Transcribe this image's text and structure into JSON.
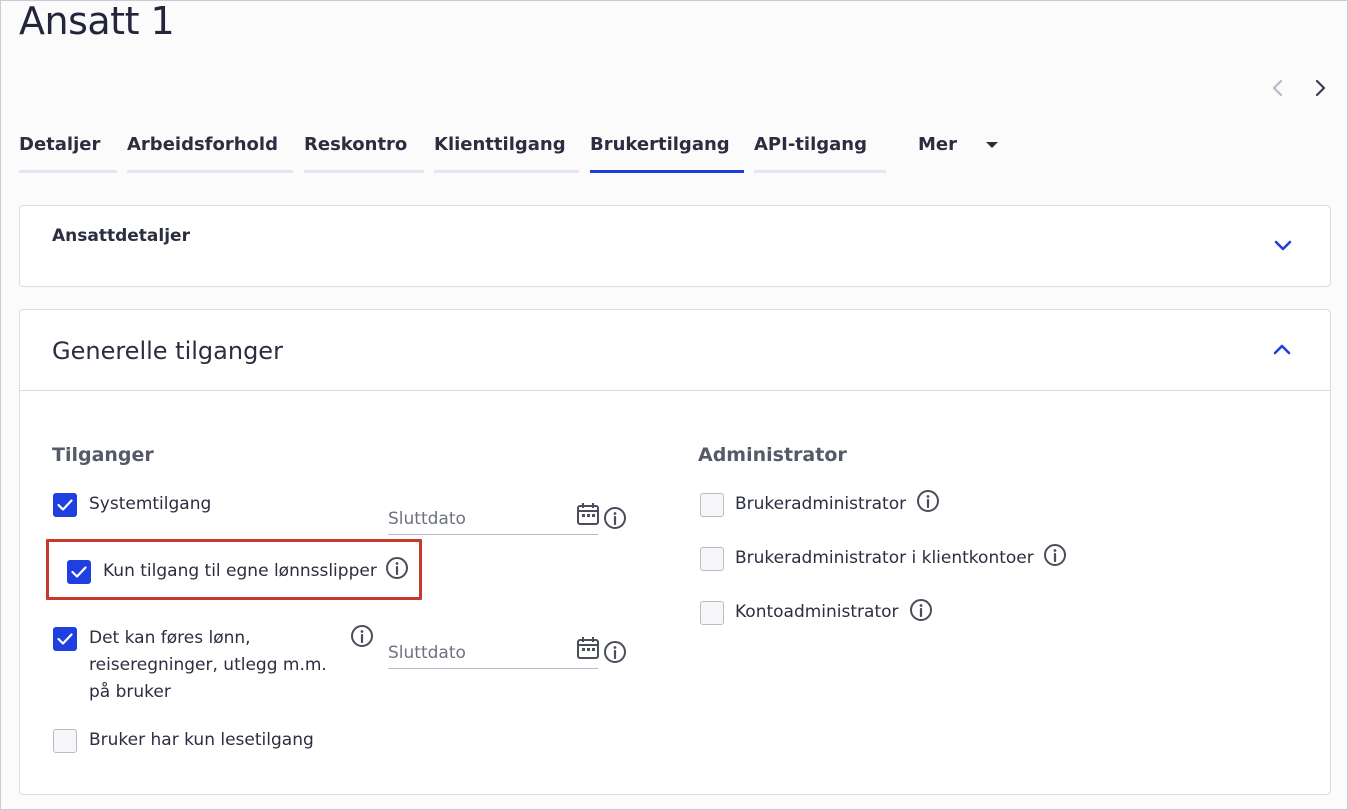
{
  "page": {
    "title": "Ansatt 1"
  },
  "tabs": [
    {
      "label": "Detaljer"
    },
    {
      "label": "Arbeidsforhold"
    },
    {
      "label": "Reskontro"
    },
    {
      "label": "Klienttilgang"
    },
    {
      "label": "Brukertilgang"
    },
    {
      "label": "API-tilgang"
    }
  ],
  "tabs_more": {
    "label": "Mer"
  },
  "active_tab": "Brukertilgang",
  "section_employee": {
    "title": "Ansattdetaljer",
    "expanded": false
  },
  "section_access": {
    "title": "Generelle tilganger",
    "expanded": true,
    "access_group": {
      "heading": "Tilganger",
      "system_access": {
        "label": "Systemtilgang",
        "checked": true,
        "end_date_placeholder": "Sluttdato"
      },
      "own_payslips": {
        "label": "Kun tilgang til egne lønnsslipper",
        "checked": true
      },
      "payroll_on_user": {
        "label": "Det kan føres lønn, reiseregninger, utlegg m.m. på bruker",
        "checked": true,
        "end_date_placeholder": "Sluttdato"
      },
      "read_only": {
        "label": "Bruker har kun lesetilgang",
        "checked": false
      }
    },
    "admin_group": {
      "heading": "Administrator",
      "items": [
        {
          "label": "Brukeradministrator",
          "checked": false
        },
        {
          "label": "Brukeradministrator i klientkontoer",
          "checked": false
        },
        {
          "label": "Kontoadministrator",
          "checked": false
        }
      ]
    }
  },
  "colors": {
    "accent": "#1f3fe0",
    "highlight_border": "#c8392b"
  },
  "icons": [
    "chevron-left-icon",
    "chevron-right-icon",
    "caret-down-icon",
    "chevron-down-icon",
    "chevron-up-icon",
    "check-icon",
    "calendar-icon",
    "info-icon"
  ]
}
